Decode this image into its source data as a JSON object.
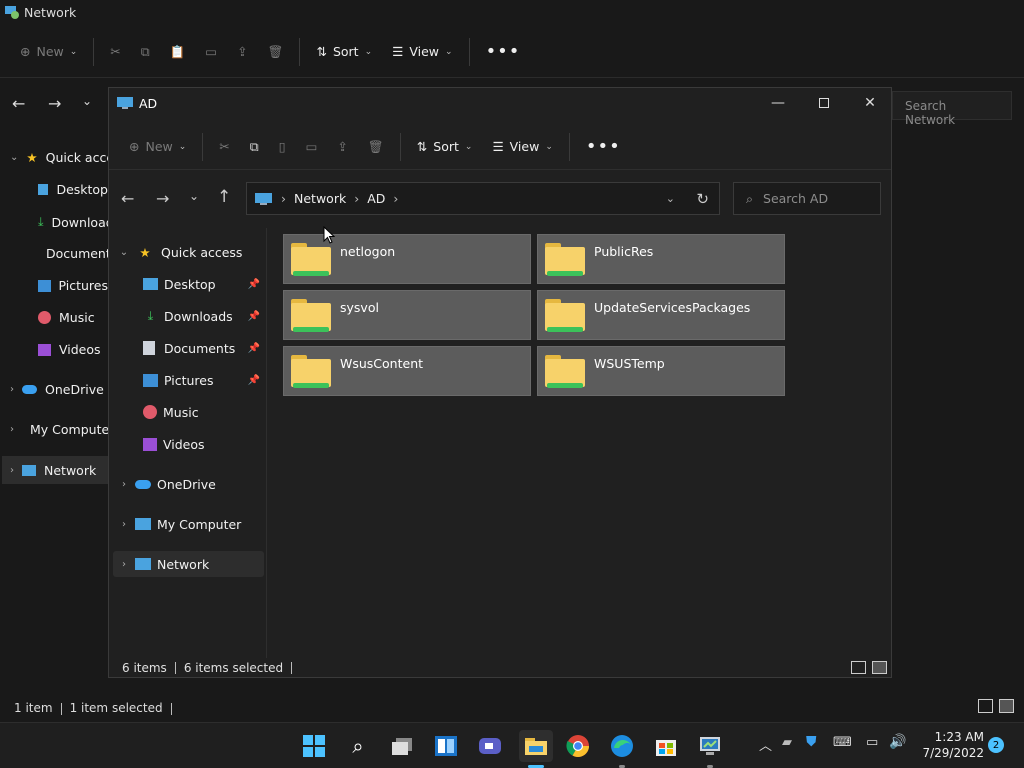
{
  "background_window": {
    "title": "Network",
    "toolbar": {
      "new_label": "New",
      "sort_label": "Sort",
      "view_label": "View"
    },
    "search_placeholder": "Search Network",
    "nav": [
      {
        "label": "Quick access",
        "icon": "star-icon"
      },
      {
        "label": "Desktop",
        "icon": "desktop-icon"
      },
      {
        "label": "Downloads",
        "icon": "downloads-icon"
      },
      {
        "label": "Documents",
        "icon": "documents-icon"
      },
      {
        "label": "Pictures",
        "icon": "pictures-icon"
      },
      {
        "label": "Music",
        "icon": "music-icon"
      },
      {
        "label": "Videos",
        "icon": "videos-icon"
      },
      {
        "label": "OneDrive",
        "icon": "cloud-icon"
      },
      {
        "label": "My Computer",
        "icon": "computer-icon"
      },
      {
        "label": "Network",
        "icon": "network-icon"
      }
    ],
    "status": {
      "items": "1 item",
      "selected": "1 item selected"
    }
  },
  "window": {
    "title": "AD",
    "toolbar": {
      "new_label": "New",
      "sort_label": "Sort",
      "view_label": "View"
    },
    "breadcrumb": [
      "Network",
      "AD"
    ],
    "search_placeholder": "Search AD",
    "nav": [
      {
        "label": "Quick access",
        "icon": "star-icon",
        "expandable": true
      },
      {
        "label": "Desktop",
        "icon": "desktop-icon",
        "pinned": true
      },
      {
        "label": "Downloads",
        "icon": "downloads-icon",
        "pinned": true
      },
      {
        "label": "Documents",
        "icon": "documents-icon",
        "pinned": true
      },
      {
        "label": "Pictures",
        "icon": "pictures-icon",
        "pinned": true
      },
      {
        "label": "Music",
        "icon": "music-icon"
      },
      {
        "label": "Videos",
        "icon": "videos-icon"
      },
      {
        "label": "OneDrive",
        "icon": "cloud-icon"
      },
      {
        "label": "My Computer",
        "icon": "computer-icon"
      },
      {
        "label": "Network",
        "icon": "network-icon",
        "selected": true
      }
    ],
    "folders": [
      "netlogon",
      "PublicRes",
      "sysvol",
      "UpdateServicesPackages",
      "WsusContent",
      "WSUSTemp"
    ],
    "status": {
      "items": "6 items",
      "selected": "6 items selected"
    }
  },
  "taskbar": {
    "apps": [
      "start-icon",
      "search-icon",
      "task-view-icon",
      "widgets-icon",
      "teams-chat-icon",
      "file-explorer-icon",
      "chrome-icon",
      "edge-icon",
      "store-icon",
      "server-manager-icon"
    ],
    "time": "1:23 AM",
    "date": "7/29/2022",
    "notification_count": "2"
  },
  "colors": {
    "accent": "#4cc2ff",
    "folder": "#f7d26a",
    "selection": "#5c5c5c"
  }
}
